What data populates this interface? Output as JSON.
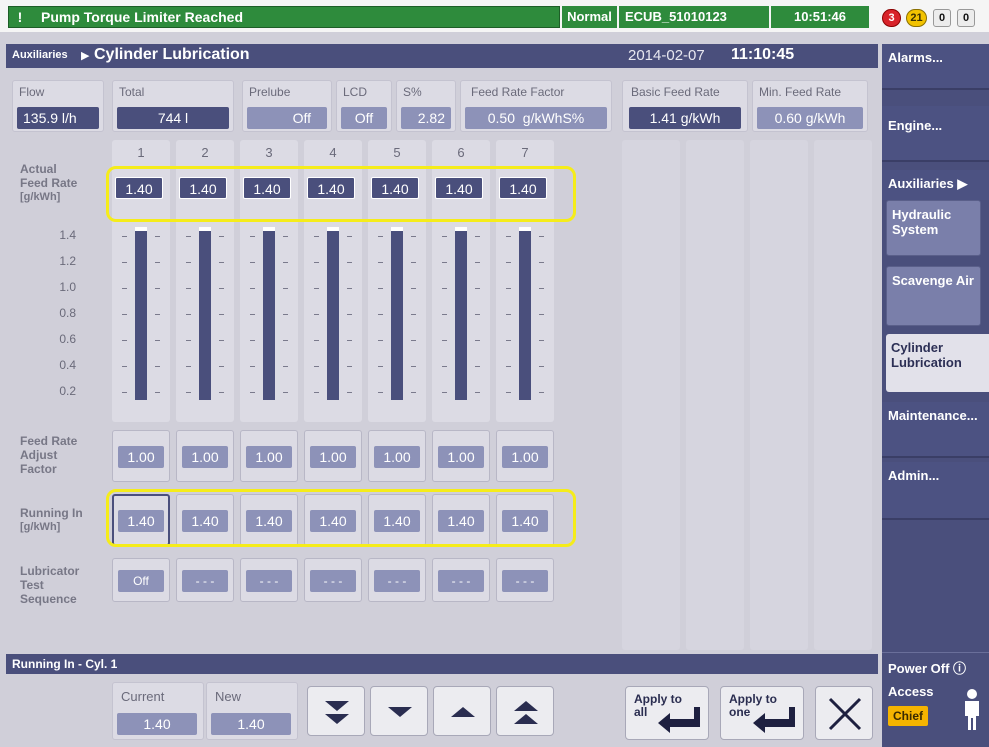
{
  "alarm": {
    "icon": "!",
    "text": "Pump Torque Limiter Reached"
  },
  "status": {
    "mode": "Normal",
    "unit": "ECUB_51010123",
    "time": "10:51:46"
  },
  "counters": {
    "red": "3",
    "yellow": "21",
    "white1": "0",
    "white2": "0"
  },
  "header": {
    "section": "Auxiliaries",
    "title": "Cylinder Lubrication",
    "date": "2014-02-07",
    "time": "11:10:45"
  },
  "top_values": {
    "flow": {
      "label": "Flow",
      "value": "135.9 l/h"
    },
    "total": {
      "label": "Total",
      "value": "744 l"
    },
    "prelube": {
      "label": "Prelube",
      "value": "Off"
    },
    "lcd": {
      "label": "LCD",
      "value": "Off"
    },
    "s_pct": {
      "label": "S%",
      "value": "2.82"
    },
    "feed_rate_factor": {
      "label": "Feed Rate Factor",
      "value": "0.50  g/kWhS%"
    },
    "basic_feed_rate": {
      "label": "Basic Feed Rate",
      "value": "1.41 g/kWh"
    },
    "min_feed_rate": {
      "label": "Min. Feed Rate",
      "value": "0.60 g/kWh"
    }
  },
  "cylinders": [
    "1",
    "2",
    "3",
    "4",
    "5",
    "6",
    "7"
  ],
  "rows": {
    "actual_feed_rate": {
      "label_lines": [
        "Actual",
        "Feed Rate",
        "[g/kWh]"
      ],
      "values": [
        "1.40",
        "1.40",
        "1.40",
        "1.40",
        "1.40",
        "1.40",
        "1.40"
      ]
    },
    "feed_rate_adjust": {
      "label_lines": [
        "Feed Rate",
        "Adjust",
        "Factor"
      ],
      "values": [
        "1.00",
        "1.00",
        "1.00",
        "1.00",
        "1.00",
        "1.00",
        "1.00"
      ]
    },
    "running_in": {
      "label_lines": [
        "Running In",
        "[g/kWh]"
      ],
      "values": [
        "1.40",
        "1.40",
        "1.40",
        "1.40",
        "1.40",
        "1.40",
        "1.40"
      ]
    },
    "lubricator_test": {
      "label_lines": [
        "Lubricator",
        "Test",
        "Sequence"
      ],
      "values": [
        "Off",
        "- - -",
        "- - -",
        "- - -",
        "- - -",
        "- - -",
        "- - -"
      ]
    }
  },
  "bar_scale": [
    "1.4",
    "1.2",
    "1.0",
    "0.8",
    "0.6",
    "0.4",
    "0.2"
  ],
  "bar_levels": [
    1.4,
    1.4,
    1.4,
    1.4,
    1.4,
    1.4,
    1.4
  ],
  "footer": {
    "title": "Running In - Cyl. 1",
    "current_label": "Current",
    "current_value": "1.40",
    "new_label": "New",
    "new_value": "1.40",
    "apply_all_label": "Apply to all",
    "apply_one_label": "Apply to one"
  },
  "sidebar": {
    "alarms": "Alarms...",
    "engine": "Engine...",
    "auxiliaries": "Auxiliaries",
    "hydraulic": "Hydraulic System",
    "scavenge": "Scavenge Air",
    "cylinder": "Cylinder Lubrication",
    "maintenance": "Maintenance...",
    "admin": "Admin...",
    "power_off": "Power Off",
    "access_label": "Access",
    "access_level": "Chief"
  },
  "colors": {
    "accent": "#4a4f7c",
    "highlight": "#f5ec1a",
    "alarm_green": "#2e8b3c"
  }
}
